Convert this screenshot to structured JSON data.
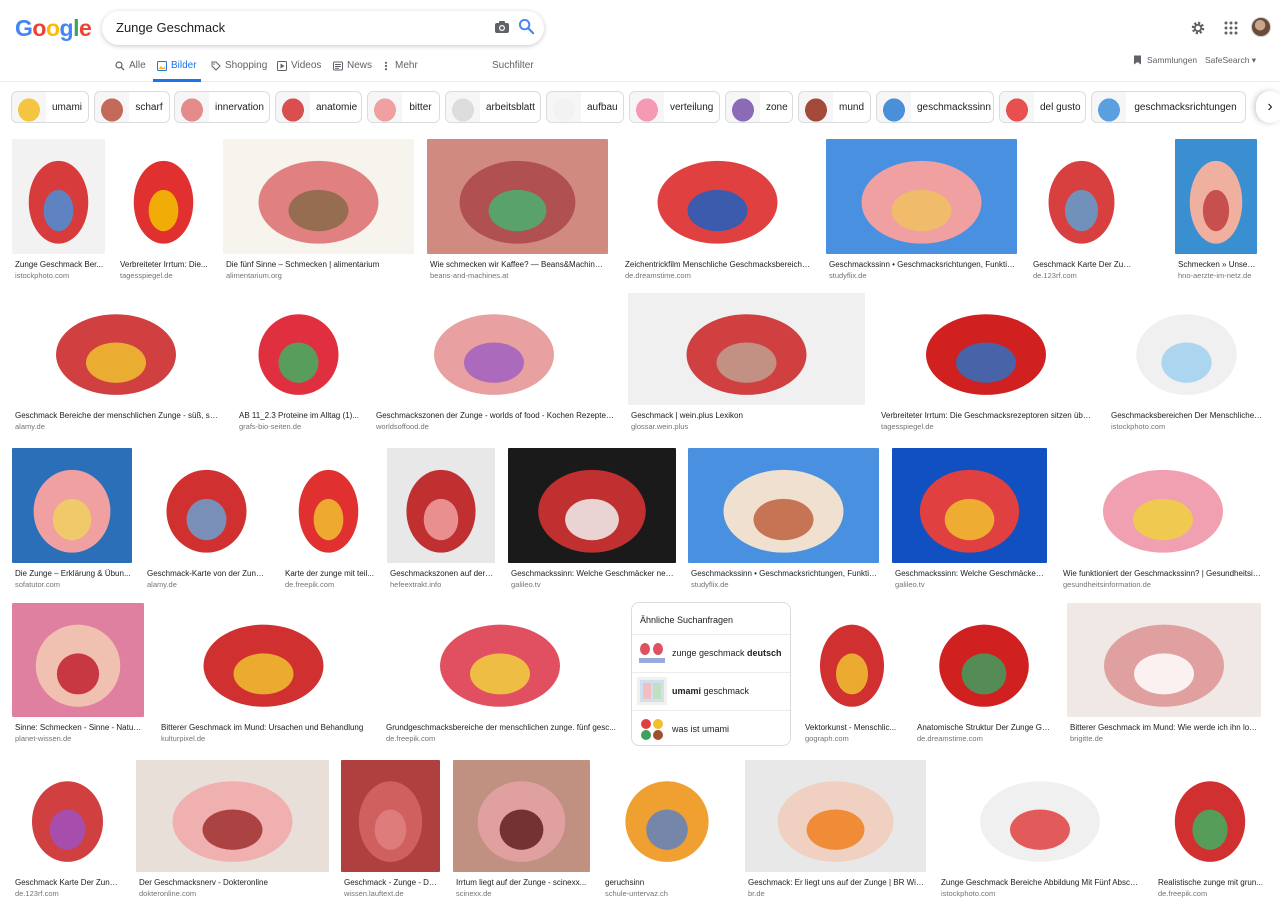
{
  "search": {
    "query": "Zunge Geschmack"
  },
  "logo": {
    "letters": [
      "G",
      "o",
      "o",
      "g",
      "l",
      "e"
    ],
    "colors": [
      "#4285f4",
      "#ea4335",
      "#fbbc05",
      "#4285f4",
      "#34a853",
      "#ea4335"
    ]
  },
  "tabs": [
    {
      "label": "Alle",
      "icon": "search-icon"
    },
    {
      "label": "Bilder",
      "icon": "image-icon"
    },
    {
      "label": "Shopping",
      "icon": "tag-icon"
    },
    {
      "label": "Videos",
      "icon": "play-icon"
    },
    {
      "label": "News",
      "icon": "news-icon"
    },
    {
      "label": "Mehr",
      "icon": "more-icon"
    },
    {
      "label": "Suchfilter",
      "icon": ""
    }
  ],
  "toolbar": {
    "sammlungen": "Sammlungen",
    "safesearch": "SafeSearch ▾"
  },
  "chips": [
    "umami",
    "scharf",
    "innervation",
    "anatomie",
    "bitter",
    "arbeitsblatt",
    "aufbau",
    "verteilung",
    "zone",
    "mund",
    "geschmackssinn",
    "del gusto",
    "geschmacksrichtungen"
  ],
  "chip_colors": [
    "#f4c542",
    "#c46a5a",
    "#e58b8b",
    "#d94f4f",
    "#f0a0a0",
    "#dddddd",
    "#f2f2f2",
    "#f49ab4",
    "#8b6bb5",
    "#a34a3a",
    "#4a90d9",
    "#e85050",
    "#5aa0e0"
  ],
  "results": [
    {
      "title": "Zunge Geschmack Ber...",
      "source": "istockphoto.com",
      "colors": [
        "#f2f2f2",
        "#d83b3b",
        "#4a8fd8"
      ]
    },
    {
      "title": "Verbreiteter Irrtum: Die...",
      "source": "tagesspiegel.de",
      "colors": [
        "#ffffff",
        "#e03030",
        "#f3c200"
      ]
    },
    {
      "title": "Die fünf Sinne – Schmecken | alimentarium",
      "source": "alimentarium.org",
      "colors": [
        "#f7f4ee",
        "#e08080",
        "#8a6a4a"
      ]
    },
    {
      "title": "Wie schmecken wir Kaffee? — Beans&Machines-...",
      "source": "beans-and-machines.at",
      "colors": [
        "#d08a80",
        "#b05050",
        "#4ab070"
      ]
    },
    {
      "title": "Zeichentrickfilm Menschliche Geschmacksbereiche...",
      "source": "de.dreamstime.com",
      "colors": [
        "#ffffff",
        "#e04040",
        "#2060c0"
      ]
    },
    {
      "title": "Geschmackssinn • Geschmacksrichtungen, Funktio...",
      "source": "studyflix.de",
      "colors": [
        "#4a90e0",
        "#f0a0a0",
        "#f0c060"
      ]
    },
    {
      "title": "Geschmack Karte Der Zunge Mit ...",
      "source": "de.123rf.com",
      "colors": [
        "#ffffff",
        "#d84040",
        "#60a0d0"
      ]
    },
    {
      "title": "Schmecken » Unsere Si...",
      "source": "hno-aerzte-im-netz.de",
      "colors": [
        "#3a8fd0",
        "#f0b0a0",
        "#c04040"
      ]
    },
    {
      "title": "Geschmack Bereiche der menschlichen Zunge - süß, sau...",
      "source": "alamy.de",
      "colors": [
        "#ffffff",
        "#d04040",
        "#f0c030"
      ]
    },
    {
      "title": "AB 11_2.3 Proteine im Alltag (1)...",
      "source": "grafs-bio-seiten.de",
      "colors": [
        "#ffffff",
        "#e03040",
        "#40b060"
      ]
    },
    {
      "title": "Geschmackszonen der Zunge - worlds of food - Kochen Rezepte ...",
      "source": "worldsoffood.de",
      "colors": [
        "#ffffff",
        "#e8a0a0",
        "#a060c0"
      ]
    },
    {
      "title": "Geschmack | wein.plus Lexikon",
      "source": "glossar.wein.plus",
      "colors": [
        "#f0f0f0",
        "#d04040",
        "#c0a090"
      ]
    },
    {
      "title": "Verbreiteter Irrtum: Die Geschmacksrezeptoren sitzen übe...",
      "source": "tagesspiegel.de",
      "colors": [
        "#ffffff",
        "#d02020",
        "#3070c0"
      ]
    },
    {
      "title": "Geschmacksbereichen Der Menschlichen ...",
      "source": "istockphoto.com",
      "colors": [
        "#ffffff",
        "#f0f0f0",
        "#a0d0f0"
      ]
    },
    {
      "title": "Die Zunge – Erklärung & Übun...",
      "source": "sofatutor.com",
      "colors": [
        "#2a6fb8",
        "#f0a0a0",
        "#f0d060"
      ]
    },
    {
      "title": "Geschmack-Karte von der Zunge...",
      "source": "alamy.de",
      "colors": [
        "#ffffff",
        "#d03030",
        "#6aa0d0"
      ]
    },
    {
      "title": "Karte der zunge mit teil...",
      "source": "de.freepik.com",
      "colors": [
        "#ffffff",
        "#e03030",
        "#f0c030"
      ]
    },
    {
      "title": "Geschmackszonen auf der ...",
      "source": "hefeextrakt.info",
      "colors": [
        "#e8e8e8",
        "#c03030",
        "#f0a0a0"
      ]
    },
    {
      "title": "Geschmackssinn: Welche Geschmäcker neh...",
      "source": "galileo.tv",
      "colors": [
        "#1a1a1a",
        "#c03030",
        "#f0f0f0"
      ]
    },
    {
      "title": "Geschmackssinn • Geschmacksrichtungen, Funktio...",
      "source": "studyflix.de",
      "colors": [
        "#4a90e0",
        "#f0e0d0",
        "#c06040"
      ]
    },
    {
      "title": "Geschmackssinn: Welche Geschmäcker ...",
      "source": "galileo.tv",
      "colors": [
        "#1050c0",
        "#e04040",
        "#f0c030"
      ]
    },
    {
      "title": "Wie funktioniert der Geschmackssinn? | Gesundheitsinf...",
      "source": "gesundheitsinformation.de",
      "colors": [
        "#ffffff",
        "#f0a0b0",
        "#f0d040"
      ]
    },
    {
      "title": "Sinne: Schmecken - Sinne - Natur - ...",
      "source": "planet-wissen.de",
      "colors": [
        "#e080a0",
        "#f0c0b0",
        "#c02030"
      ]
    },
    {
      "title": "Bitterer Geschmack im Mund: Ursachen und Behandlung",
      "source": "kulturpixel.de",
      "colors": [
        "#ffffff",
        "#d03030",
        "#f0c030"
      ]
    },
    {
      "title": "Grundgeschmacksbereiche der menschlichen zunge. fünf gesc...",
      "source": "de.freepik.com",
      "colors": [
        "#ffffff",
        "#e05060",
        "#f0d040"
      ]
    },
    {
      "title": "Vektorkunst - Menschlic...",
      "source": "gograph.com",
      "colors": [
        "#ffffff",
        "#d03030",
        "#f0c030"
      ]
    },
    {
      "title": "Anatomische Struktur Der Zunge Ge...",
      "source": "de.dreamstime.com",
      "colors": [
        "#ffffff",
        "#d02020",
        "#40a060"
      ]
    },
    {
      "title": "Bitterer Geschmack im Mund: Wie werde ich ihn los? |...",
      "source": "brigitte.de",
      "colors": [
        "#f0e8e4",
        "#e0a0a0",
        "#ffffff"
      ]
    },
    {
      "title": "Geschmack Karte Der Zunge...",
      "source": "de.123rf.com",
      "colors": [
        "#ffffff",
        "#d04040",
        "#a050c0"
      ]
    },
    {
      "title": "Der Geschmacksnerv - Dokteronline",
      "source": "dokteronline.com",
      "colors": [
        "#e8e0d8",
        "#f0b0b0",
        "#a03030"
      ]
    },
    {
      "title": "Geschmack - Zunge - Der...",
      "source": "wissen.lauftext.de",
      "colors": [
        "#b04040",
        "#d06060",
        "#e08080"
      ]
    },
    {
      "title": "Irrtum liegt auf der Zunge - scinexx...",
      "source": "scinexx.de",
      "colors": [
        "#c09080",
        "#e0a0a0",
        "#602020"
      ]
    },
    {
      "title": "geruchsinn",
      "source": "schule-untervaz.ch",
      "colors": [
        "#ffffff",
        "#f0a030",
        "#6080c0"
      ]
    },
    {
      "title": "Geschmack: Er liegt uns auf der Zunge | BR Wis...",
      "source": "br.de",
      "colors": [
        "#e8e8e8",
        "#f0d0c0",
        "#f08020"
      ]
    },
    {
      "title": "Zunge Geschmack Bereiche Abbildung Mit Fünf Absch...",
      "source": "istockphoto.com",
      "colors": [
        "#ffffff",
        "#f0f0f0",
        "#e04040"
      ]
    },
    {
      "title": "Realistische zunge mit grun...",
      "source": "de.freepik.com",
      "colors": [
        "#ffffff",
        "#d03030",
        "#40b060"
      ]
    }
  ],
  "related": {
    "heading": "Ähnliche Suchanfragen",
    "items": [
      {
        "pre": "zunge geschmack ",
        "bold": "deutsch",
        "post": ""
      },
      {
        "pre": "",
        "bold": "umami",
        "post": " geschmack"
      },
      {
        "pre": "was ist umami",
        "bold": "",
        "post": ""
      }
    ]
  }
}
